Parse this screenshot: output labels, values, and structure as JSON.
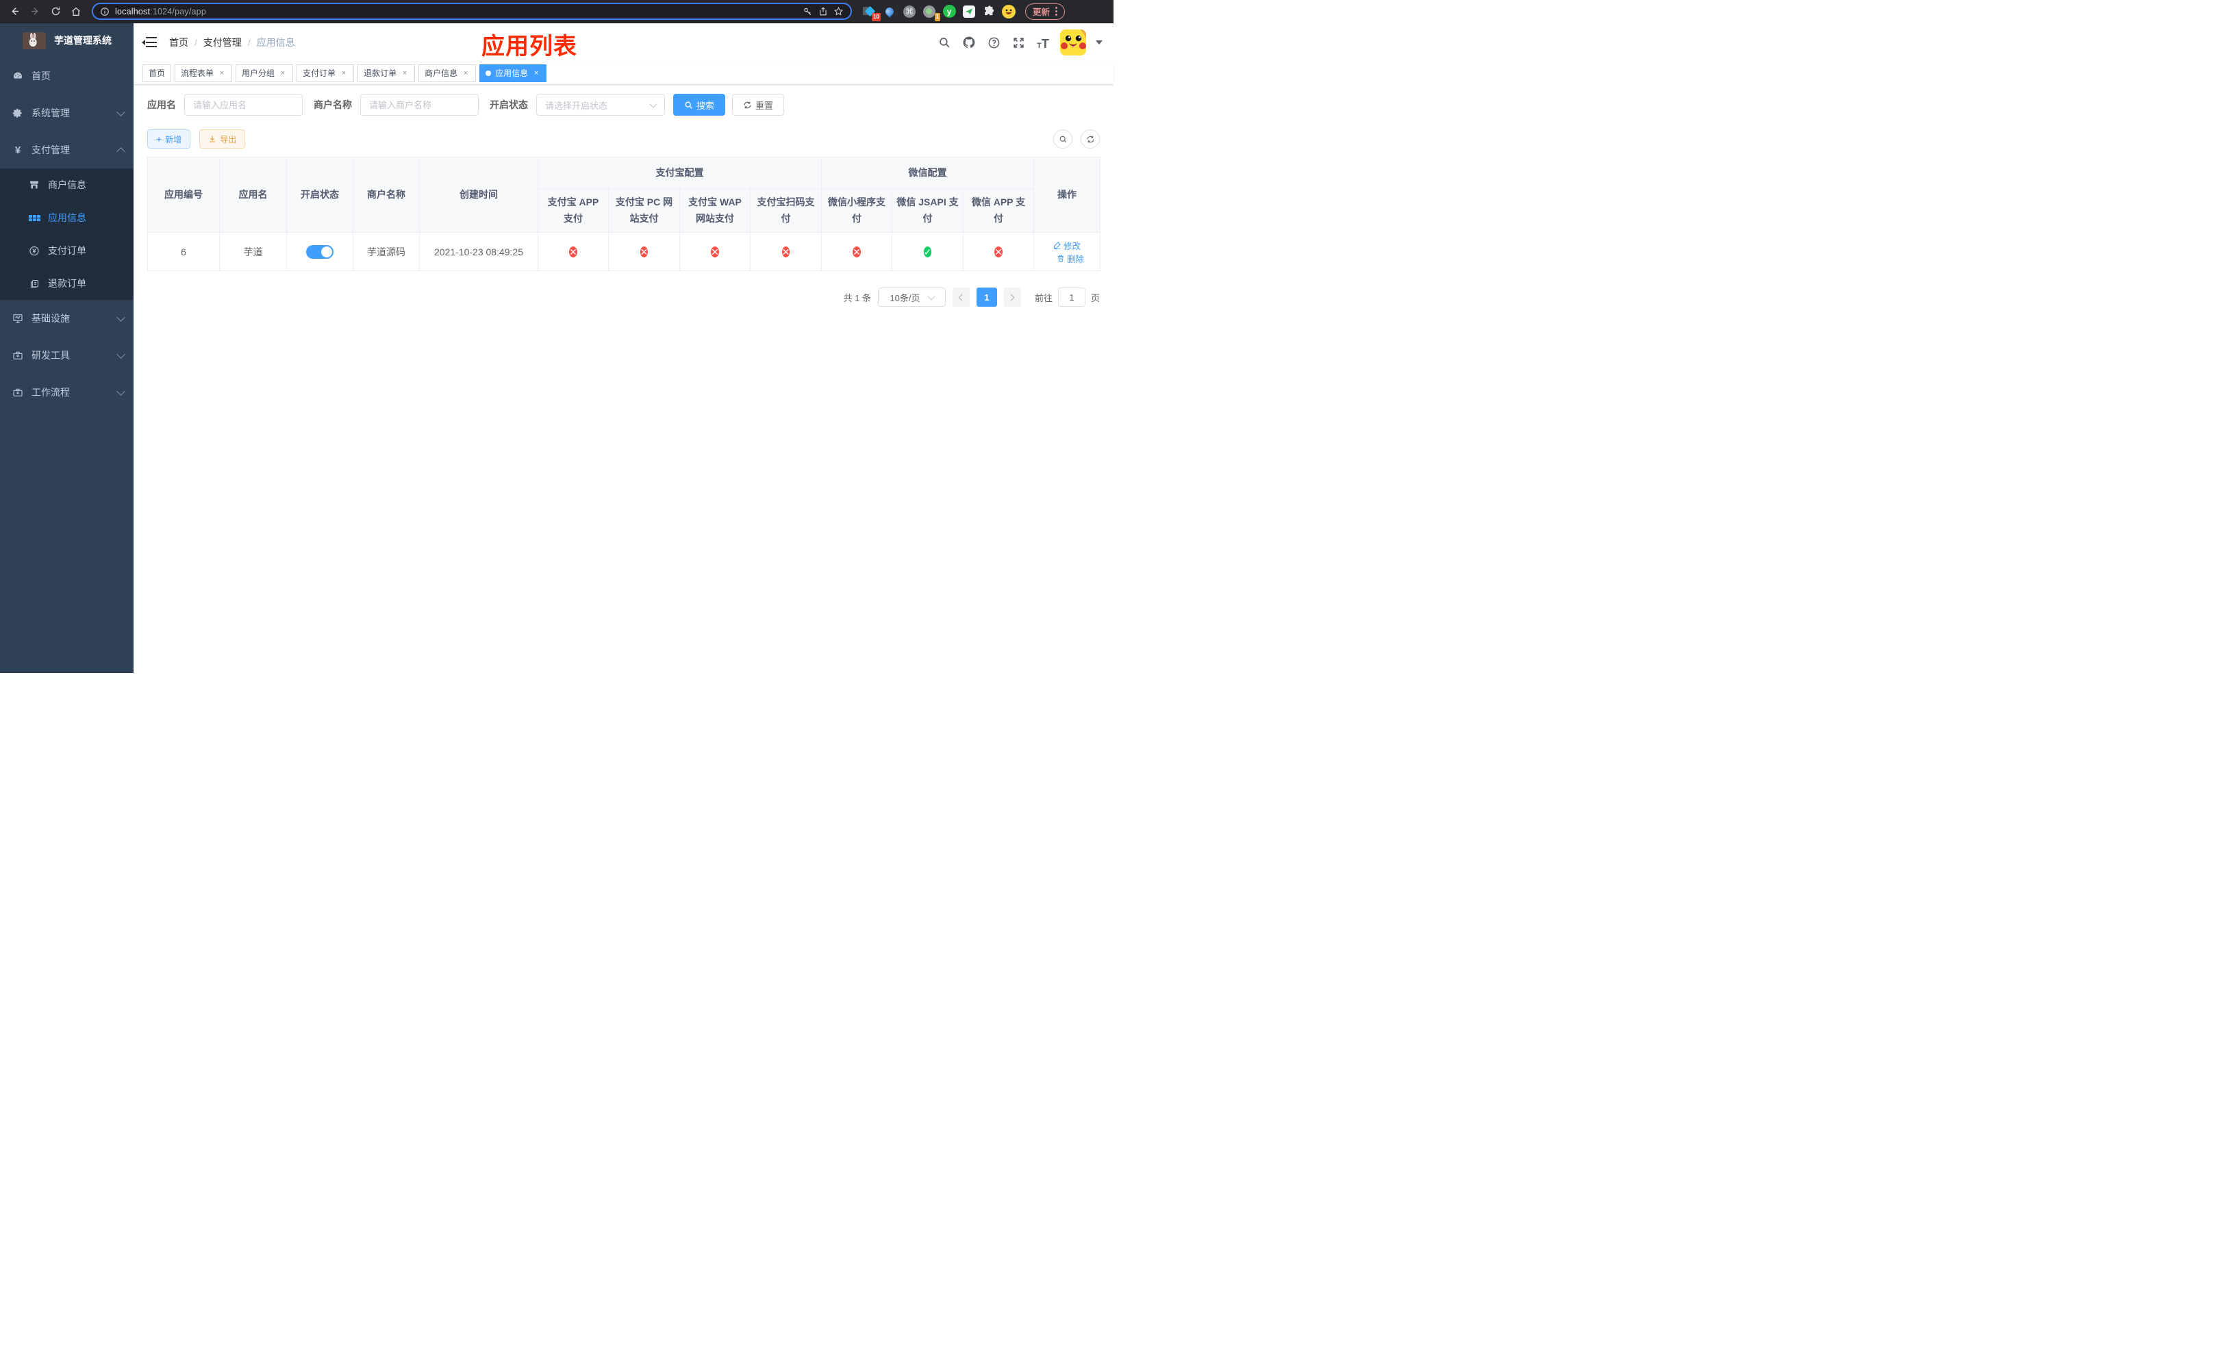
{
  "icons": {
    "close": "×",
    "check": "✓",
    "cross": "✕",
    "plus": "+",
    "command": "⌘",
    "ext_letter": "y"
  },
  "browser": {
    "url_host": "localhost",
    "url_rest": ":1024/pay/app",
    "update_label": "更新",
    "ext_badge_10": "10",
    "ext_badge_1": "1"
  },
  "sidebar": {
    "title": "芋道管理系统",
    "items": [
      {
        "label": "首页"
      },
      {
        "label": "系统管理"
      },
      {
        "label": "支付管理"
      },
      {
        "label": "基础设施"
      },
      {
        "label": "研发工具"
      },
      {
        "label": "工作流程"
      }
    ],
    "submenu": [
      {
        "label": "商户信息"
      },
      {
        "label": "应用信息"
      },
      {
        "label": "支付订单"
      },
      {
        "label": "退款订单"
      }
    ]
  },
  "header": {
    "breadcrumb": [
      "首页",
      "支付管理",
      "应用信息"
    ],
    "annotation": "应用列表"
  },
  "tabs": [
    {
      "label": "首页"
    },
    {
      "label": "流程表单"
    },
    {
      "label": "用户分组"
    },
    {
      "label": "支付订单"
    },
    {
      "label": "退款订单"
    },
    {
      "label": "商户信息"
    },
    {
      "label": "应用信息"
    }
  ],
  "filters": {
    "app_name_label": "应用名",
    "app_name_placeholder": "请输入应用名",
    "merchant_label": "商户名称",
    "merchant_placeholder": "请输入商户名称",
    "status_label": "开启状态",
    "status_placeholder": "请选择开启状态",
    "search_label": "搜索",
    "reset_label": "重置"
  },
  "toolbar": {
    "add_label": "新增",
    "export_label": "导出"
  },
  "table": {
    "group_headers": {
      "alipay": "支付宝配置",
      "wechat": "微信配置"
    },
    "columns": [
      "应用编号",
      "应用名",
      "开启状态",
      "商户名称",
      "创建时间",
      "支付宝 APP 支付",
      "支付宝 PC 网站支付",
      "支付宝 WAP 网站支付",
      "支付宝扫码支付",
      "微信小程序支付",
      "微信 JSAPI 支付",
      "微信 APP 支付",
      "操作"
    ],
    "row": {
      "id": "6",
      "name": "芋道",
      "enabled": true,
      "merchant": "芋道源码",
      "created_at": "2021-10-23 08:49:25",
      "statuses": [
        false,
        false,
        false,
        false,
        false,
        true,
        false
      ],
      "actions": [
        "修改",
        "删除"
      ]
    }
  },
  "pagination": {
    "total": "共 1 条",
    "page_size": "10条/页",
    "page": "1",
    "goto_label": "前往",
    "goto_value": "1",
    "page_unit": "页"
  }
}
